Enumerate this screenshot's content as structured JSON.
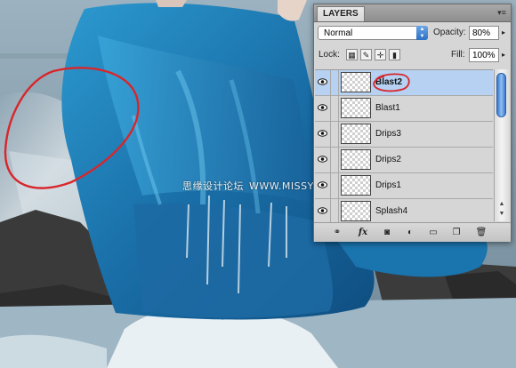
{
  "watermark": {
    "left_text": "思缘设计论坛",
    "right_text": "WWW.MISSYUAN.COM"
  },
  "panel": {
    "tab_label": "LAYERS",
    "menu_icon": "panel-menu-icon",
    "blend_mode": "Normal",
    "opacity_label": "Opacity:",
    "opacity_value": "80%",
    "lock_label": "Lock:",
    "fill_label": "Fill:",
    "fill_value": "100%",
    "layers": [
      {
        "name": "Blast2",
        "selected": true,
        "visible": true
      },
      {
        "name": "Blast1",
        "selected": false,
        "visible": true
      },
      {
        "name": "Drips3",
        "selected": false,
        "visible": true
      },
      {
        "name": "Drips2",
        "selected": false,
        "visible": true
      },
      {
        "name": "Drips1",
        "selected": false,
        "visible": true
      },
      {
        "name": "Splash4",
        "selected": false,
        "visible": true
      }
    ],
    "bottom_icons": [
      "link-layers-icon",
      "fx-icon",
      "mask-icon",
      "adjustment-icon",
      "group-folder-icon",
      "new-layer-icon",
      "trash-icon"
    ],
    "fx_label": "fx"
  },
  "colors": {
    "selection": "#b6d1f2",
    "annotation_red": "#d8262b",
    "dress_blue": "#1f7fb8"
  }
}
